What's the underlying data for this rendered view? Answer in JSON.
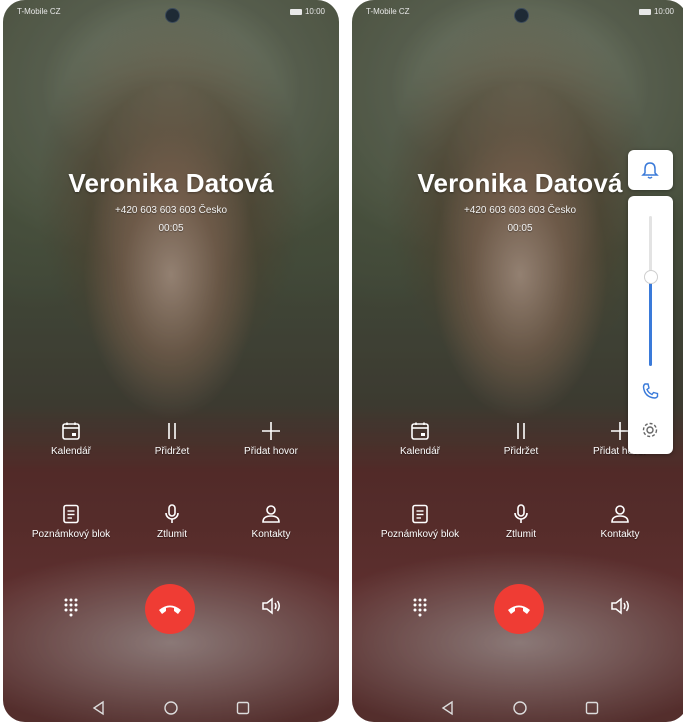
{
  "status": {
    "carrier": "T-Mobile CZ",
    "time": "10:00"
  },
  "caller": {
    "name": "Veronika Datová",
    "number": "+420 603 603 603  Česko",
    "duration": "00:05"
  },
  "controls": {
    "calendar": "Kalendář",
    "hold": "Přidržet",
    "add_call": "Přidat hovor",
    "notepad": "Poznámkový blok",
    "mute": "Ztlumit",
    "contacts": "Kontakty"
  },
  "colors": {
    "hangup": "#ef3c34",
    "volume_accent": "#3a7ad9"
  },
  "icons": [
    "calendar-icon",
    "pause-icon",
    "plus-icon",
    "note-icon",
    "microphone-icon",
    "person-icon",
    "keypad-icon",
    "end-call-icon",
    "speaker-icon",
    "back-icon",
    "home-icon",
    "recents-icon",
    "bell-icon",
    "phone-icon",
    "gear-icon"
  ],
  "volume": {
    "level": 0.6
  }
}
